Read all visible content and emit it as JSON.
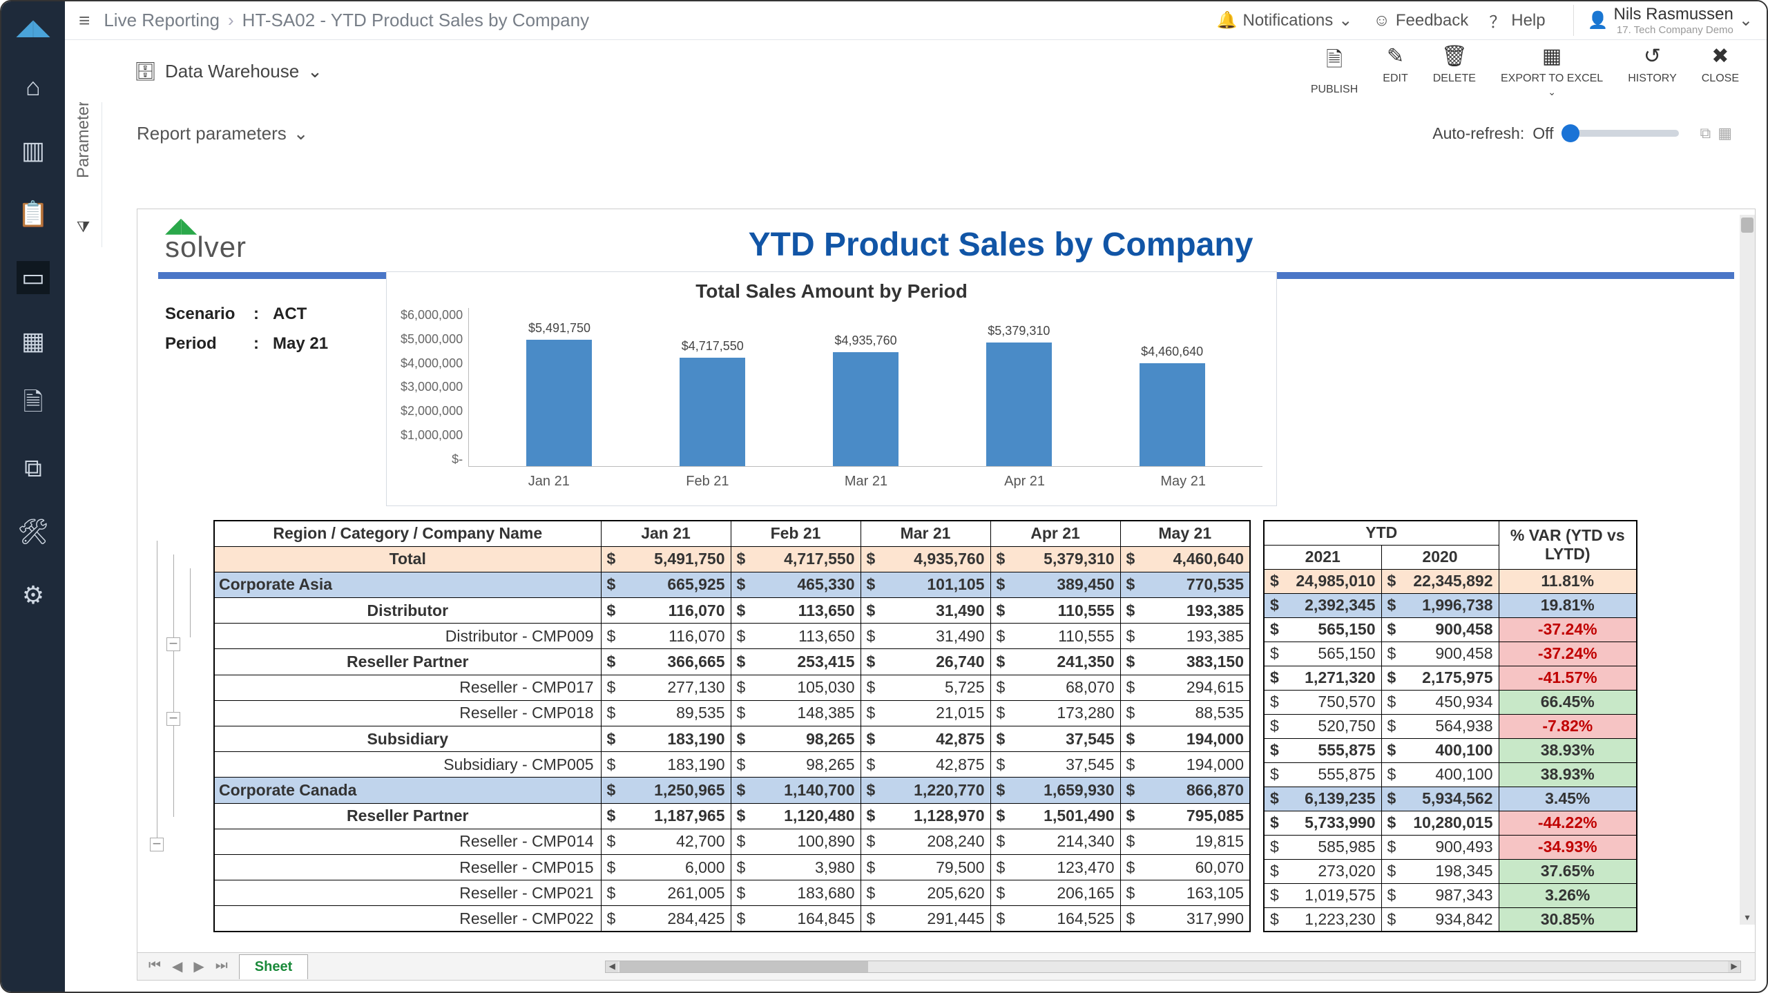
{
  "breadcrumb": {
    "root": "Live Reporting",
    "page": "HT-SA02 - YTD Product Sales by Company"
  },
  "header": {
    "notifications": "Notifications",
    "feedback": "Feedback",
    "help": "Help",
    "user_name": "Nils Rasmussen",
    "user_sub": "17. Tech Company Demo"
  },
  "params_panel": {
    "label": "Parameters"
  },
  "toolbar": {
    "datasource": "Data Warehouse",
    "publish": "PUBLISH",
    "edit": "EDIT",
    "delete": "DELETE",
    "export": "EXPORT TO EXCEL",
    "history": "HISTORY",
    "close": "CLOSE"
  },
  "report_params_label": "Report parameters",
  "auto_refresh": {
    "label": "Auto-refresh:",
    "value": "Off"
  },
  "brand": "solver",
  "report_title": "YTD Product Sales by Company",
  "scenario": {
    "label": "Scenario",
    "value": "ACT",
    "period_label": "Period",
    "period_value": "May 21"
  },
  "chart_data": {
    "type": "bar",
    "title": "Total Sales Amount by Period",
    "y_ticks": [
      "$6,000,000",
      "$5,000,000",
      "$4,000,000",
      "$3,000,000",
      "$2,000,000",
      "$1,000,000",
      "$-"
    ],
    "categories": [
      "Jan 21",
      "Feb 21",
      "Mar 21",
      "Apr 21",
      "May 21"
    ],
    "values": [
      5491750,
      4717550,
      4935760,
      5379310,
      4460640
    ],
    "value_labels": [
      "$5,491,750",
      "$4,717,550",
      "$4,935,760",
      "$5,379,310",
      "$4,460,640"
    ],
    "ymax": 6000000
  },
  "table": {
    "corner": "Region / Category / Company Name",
    "months": [
      "Jan 21",
      "Feb 21",
      "Mar 21",
      "Apr 21",
      "May 21"
    ],
    "ytd_header": "YTD",
    "ytd_years": [
      "2021",
      "2020"
    ],
    "var_header": "% VAR (YTD vs LYTD)",
    "rows": [
      {
        "type": "total",
        "label": "Total",
        "m": [
          "5,491,750",
          "4,717,550",
          "4,935,760",
          "5,379,310",
          "4,460,640"
        ],
        "y": [
          "24,985,010",
          "22,345,892"
        ],
        "v": "11.81%",
        "vc": "pos"
      },
      {
        "type": "region",
        "label": "Corporate Asia",
        "m": [
          "665,925",
          "465,330",
          "101,105",
          "389,450",
          "770,535"
        ],
        "y": [
          "2,392,345",
          "1,996,738"
        ],
        "v": "19.81%",
        "vc": "pos"
      },
      {
        "type": "cat",
        "label": "Distributor",
        "m": [
          "116,070",
          "113,650",
          "31,490",
          "110,555",
          "193,385"
        ],
        "y": [
          "565,150",
          "900,458"
        ],
        "v": "-37.24%",
        "vc": "neg"
      },
      {
        "type": "detail",
        "label": "Distributor - CMP009",
        "m": [
          "116,070",
          "113,650",
          "31,490",
          "110,555",
          "193,385"
        ],
        "y": [
          "565,150",
          "900,458"
        ],
        "v": "-37.24%",
        "vc": "neg"
      },
      {
        "type": "cat",
        "label": "Reseller Partner",
        "m": [
          "366,665",
          "253,415",
          "26,740",
          "241,350",
          "383,150"
        ],
        "y": [
          "1,271,320",
          "2,175,975"
        ],
        "v": "-41.57%",
        "vc": "neg"
      },
      {
        "type": "detail",
        "label": "Reseller - CMP017",
        "m": [
          "277,130",
          "105,030",
          "5,725",
          "68,070",
          "294,615"
        ],
        "y": [
          "750,570",
          "450,934"
        ],
        "v": "66.45%",
        "vc": "pos"
      },
      {
        "type": "detail",
        "label": "Reseller - CMP018",
        "m": [
          "89,535",
          "148,385",
          "21,015",
          "173,280",
          "88,535"
        ],
        "y": [
          "520,750",
          "564,938"
        ],
        "v": "-7.82%",
        "vc": "neg"
      },
      {
        "type": "cat",
        "label": "Subsidiary",
        "m": [
          "183,190",
          "98,265",
          "42,875",
          "37,545",
          "194,000"
        ],
        "y": [
          "555,875",
          "400,100"
        ],
        "v": "38.93%",
        "vc": "pos"
      },
      {
        "type": "detail",
        "label": "Subsidiary - CMP005",
        "m": [
          "183,190",
          "98,265",
          "42,875",
          "37,545",
          "194,000"
        ],
        "y": [
          "555,875",
          "400,100"
        ],
        "v": "38.93%",
        "vc": "pos"
      },
      {
        "type": "region",
        "label": "Corporate Canada",
        "m": [
          "1,250,965",
          "1,140,700",
          "1,220,770",
          "1,659,930",
          "866,870"
        ],
        "y": [
          "6,139,235",
          "5,934,562"
        ],
        "v": "3.45%",
        "vc": "pos"
      },
      {
        "type": "cat",
        "label": "Reseller Partner",
        "m": [
          "1,187,965",
          "1,120,480",
          "1,128,970",
          "1,501,490",
          "795,085"
        ],
        "y": [
          "5,733,990",
          "10,280,015"
        ],
        "v": "-44.22%",
        "vc": "neg"
      },
      {
        "type": "detail",
        "label": "Reseller - CMP014",
        "m": [
          "42,700",
          "100,890",
          "208,240",
          "214,340",
          "19,815"
        ],
        "y": [
          "585,985",
          "900,493"
        ],
        "v": "-34.93%",
        "vc": "neg"
      },
      {
        "type": "detail",
        "label": "Reseller - CMP015",
        "m": [
          "6,000",
          "3,980",
          "79,500",
          "123,470",
          "60,070"
        ],
        "y": [
          "273,020",
          "198,345"
        ],
        "v": "37.65%",
        "vc": "pos"
      },
      {
        "type": "detail",
        "label": "Reseller - CMP021",
        "m": [
          "261,005",
          "183,680",
          "205,620",
          "206,165",
          "163,105"
        ],
        "y": [
          "1,019,575",
          "987,343"
        ],
        "v": "3.26%",
        "vc": "pos"
      },
      {
        "type": "detail",
        "label": "Reseller - CMP022",
        "m": [
          "284,425",
          "164,845",
          "291,445",
          "164,525",
          "317,990"
        ],
        "y": [
          "1,223,230",
          "934,842"
        ],
        "v": "30.85%",
        "vc": "pos"
      }
    ]
  },
  "sheet_tab": "Sheet"
}
